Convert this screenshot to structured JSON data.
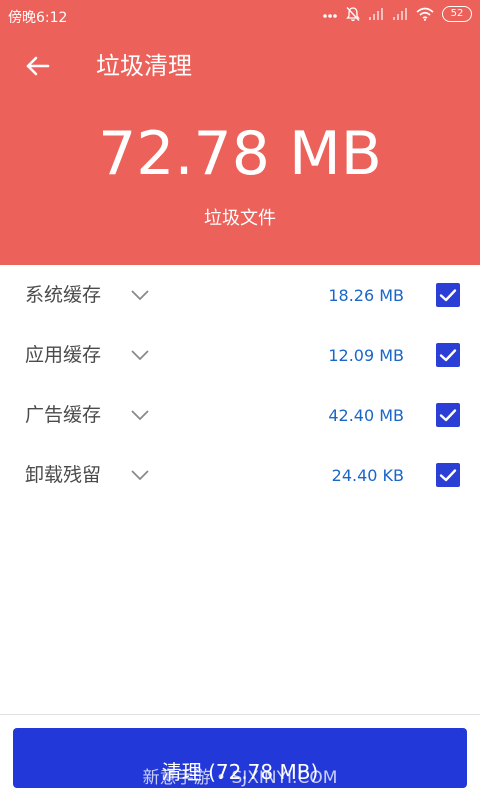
{
  "status_bar": {
    "time": "傍晚6:12",
    "battery": "52",
    "icons": [
      "dots-icon",
      "bell-off-icon",
      "signal-icon",
      "signal-icon",
      "wifi-icon",
      "battery-icon"
    ]
  },
  "toolbar": {
    "back_icon": "arrow-left-icon",
    "title": "垃圾清理"
  },
  "summary": {
    "total_size": "72.78 MB",
    "caption": "垃圾文件"
  },
  "items": [
    {
      "label": "系统缓存",
      "size": "18.26 MB",
      "checked": true
    },
    {
      "label": "应用缓存",
      "size": "12.09 MB",
      "checked": true
    },
    {
      "label": "广告缓存",
      "size": "42.40 MB",
      "checked": true
    },
    {
      "label": "卸载残留",
      "size": "24.40 KB",
      "checked": true
    }
  ],
  "footer": {
    "clean_button_label": "清理 (72.78 MB)",
    "watermark": "新意手游 • SJXINYI.COM"
  },
  "colors": {
    "header_bg": "#ec615a",
    "accent_blue": "#2238d8",
    "size_text": "#1a66c9",
    "label_text": "#4b4b4b"
  }
}
